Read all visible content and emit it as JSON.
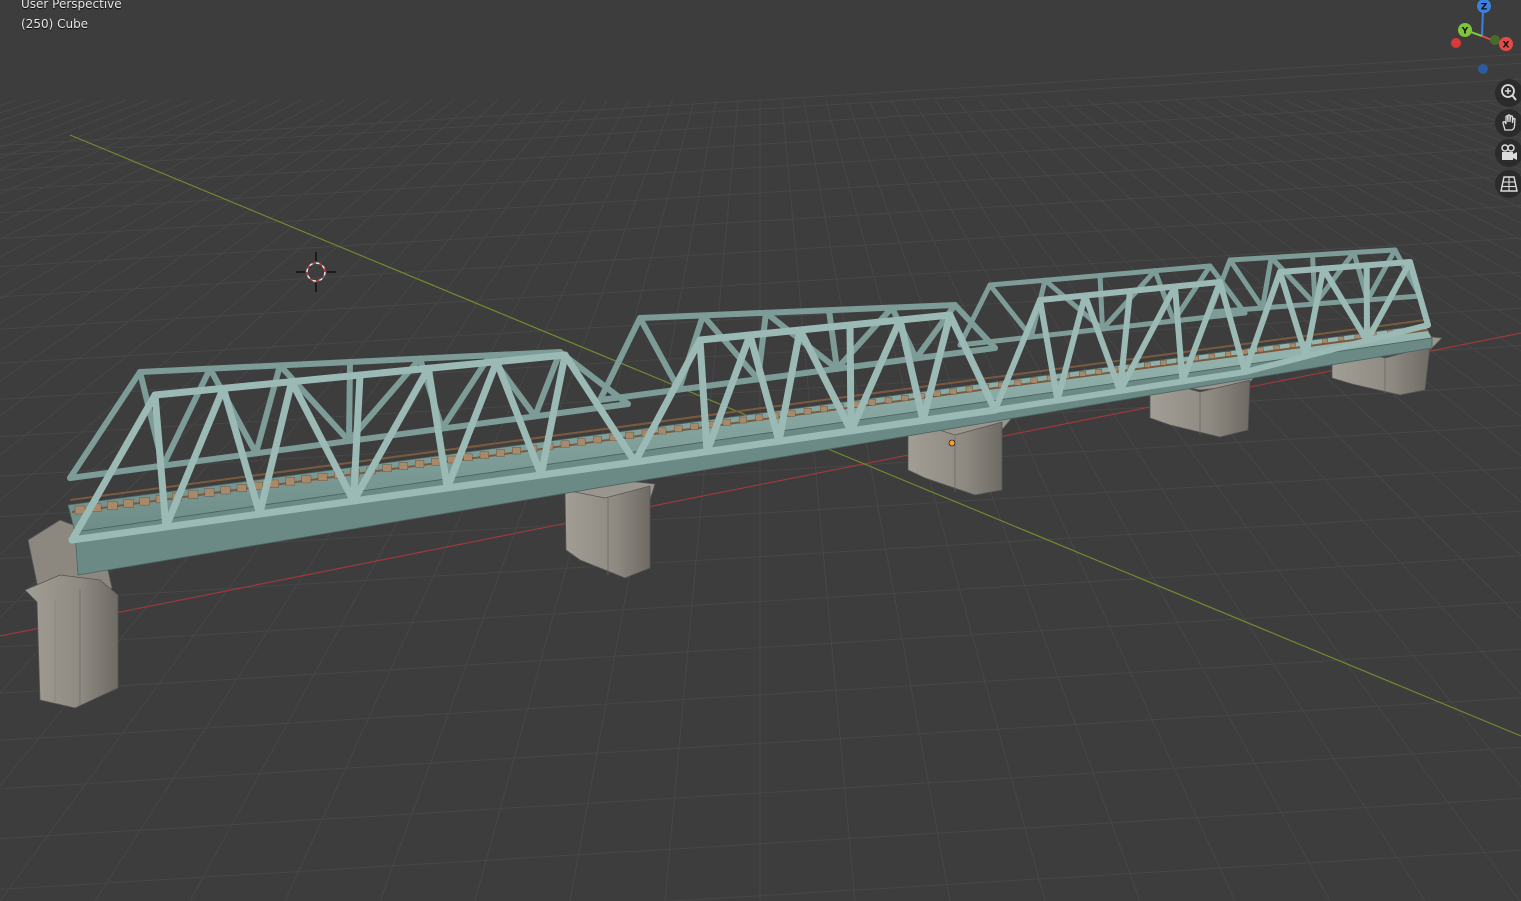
{
  "viewport": {
    "view_name": "User Perspective",
    "object_info": "(250) Cube",
    "background": "#3d3d3d"
  },
  "gizmo": {
    "z_label": "Z",
    "y_label": "Y",
    "x_label": "X",
    "x_color": "#e54a4a",
    "y_color": "#7fc43a",
    "z_color": "#3b82e0"
  },
  "navigation": {
    "zoom_icon": "zoom-icon",
    "pan_icon": "hand-pan-icon",
    "camera_icon": "camera-icon",
    "ortho_icon": "grid-ortho-icon"
  },
  "scene": {
    "grid_color": "#454545",
    "x_axis_color": "#9b3a3a",
    "y_axis_color": "#6f8a2e",
    "truss_color": "#8fb0aa",
    "pier_color": "#8a8680",
    "rail_color": "#7a5a3e"
  }
}
